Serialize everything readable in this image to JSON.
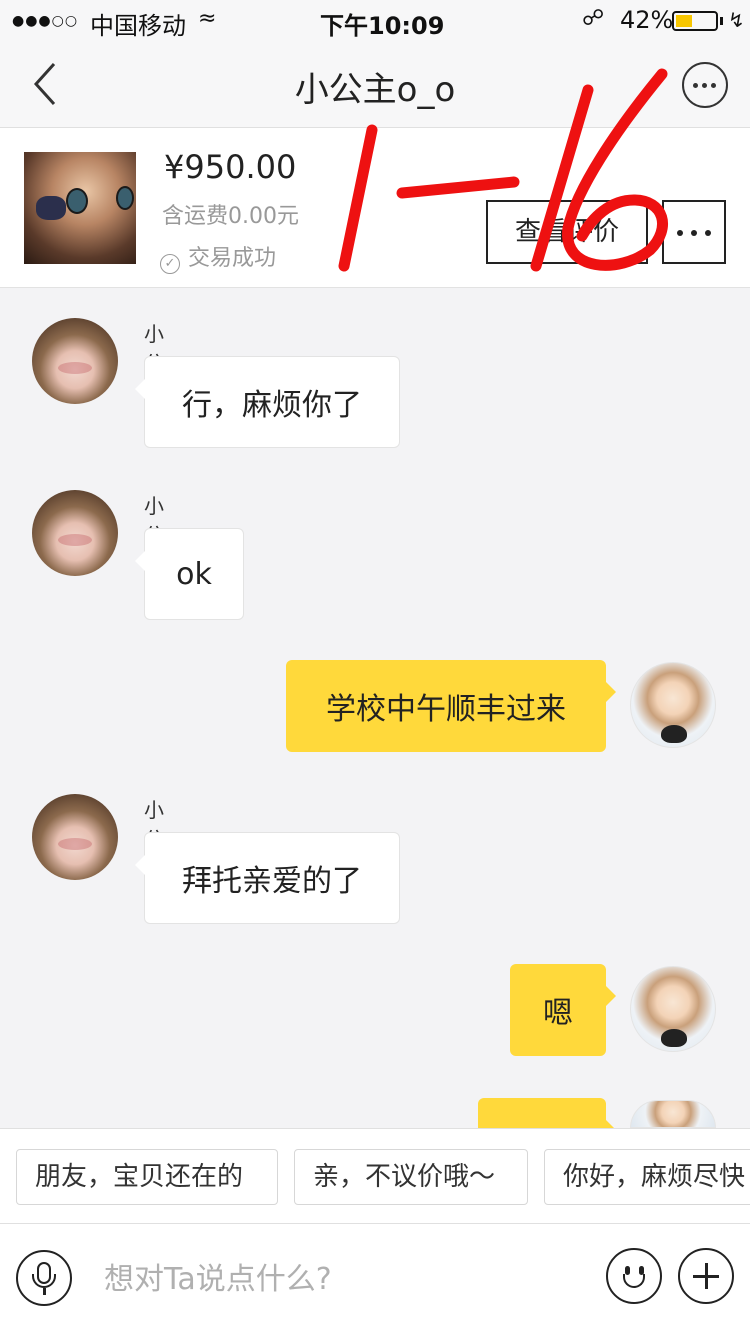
{
  "status_bar": {
    "signal": "●●●○○",
    "carrier": "中国移动",
    "time": "下午10:09",
    "battery_percent": "42%",
    "battery_level": 0.42
  },
  "header": {
    "title": "小公主o_o"
  },
  "product": {
    "price": "¥950.00",
    "shipping": "含运费0.00元",
    "trade_status": "交易成功",
    "review_button": "查看评价"
  },
  "annotation": {
    "handwritten_text": "1-16",
    "color": "#ee1111"
  },
  "messages": [
    {
      "from": "seller",
      "sender": "小公主o_o",
      "text": "行，麻烦你了"
    },
    {
      "from": "seller",
      "sender": "小公主o_o",
      "text": "ok"
    },
    {
      "from": "me",
      "text": "学校中午顺丰过来"
    },
    {
      "from": "seller",
      "sender": "小公主o_o",
      "text": "拜托亲爱的了"
    },
    {
      "from": "me",
      "text": "嗯"
    },
    {
      "from": "me",
      "text": ""
    }
  ],
  "quick_replies": [
    "朋友，宝贝还在的",
    "亲，不议价哦～",
    "你好，麻烦尽快"
  ],
  "input": {
    "placeholder": "想对Ta说点什么?"
  },
  "colors": {
    "outgoing_bubble": "#ffd93b",
    "incoming_bubble": "#ffffff",
    "background": "#f3f3f5",
    "battery": "#f7c600"
  }
}
